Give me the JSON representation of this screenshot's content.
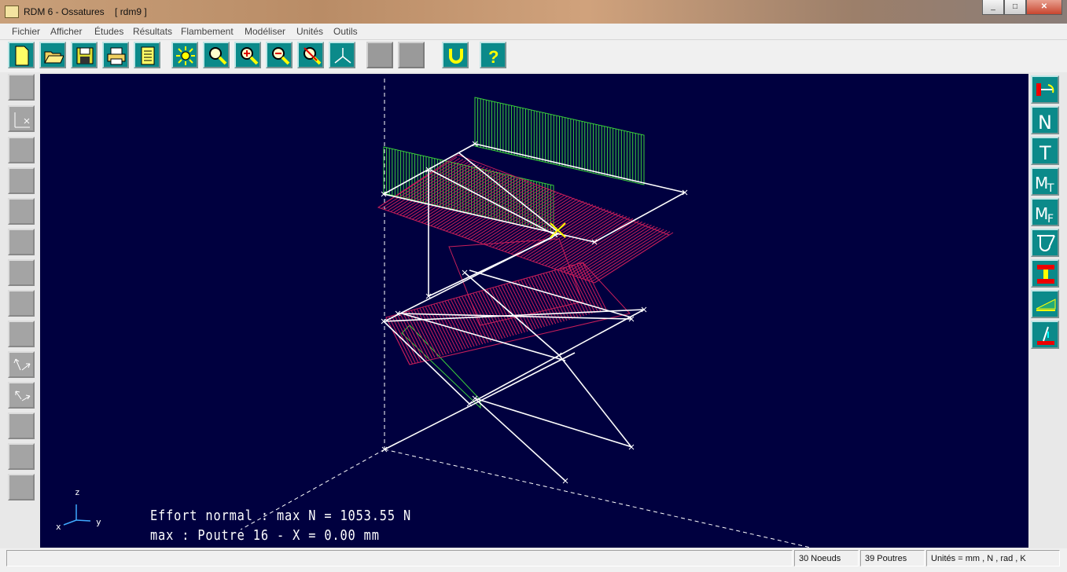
{
  "window": {
    "title": "RDM 6 - Ossatures    [ rdm9 ]",
    "controls": [
      "_",
      "□",
      "✕"
    ]
  },
  "menu": [
    "Fichier",
    "Afficher",
    "Études",
    "Résultats",
    "Flambement",
    "Modéliser",
    "Unités",
    "Outils"
  ],
  "toolbar": {
    "buttons": [
      "new-file",
      "open-folder",
      "save-disk",
      "print",
      "document-list",
      "light",
      "zoom",
      "zoom-in",
      "zoom-out",
      "zoom-reset",
      "axes",
      "blank",
      "blank",
      "magnet",
      "help"
    ]
  },
  "left_toolbar": {
    "count": 14
  },
  "right_toolbar": {
    "buttons": [
      "beam-load",
      "N",
      "T",
      "Mt",
      "Mf",
      "stress",
      "section",
      "distributed-load",
      "support"
    ]
  },
  "viewport": {
    "info_line1": "Effort normal : max N = 1053.55 N",
    "info_line2": "max : Poutre 16 - X = 0.00 mm",
    "axis": {
      "z": "z",
      "x": "x",
      "y": "y"
    },
    "background": "#00003f"
  },
  "status": {
    "nodes": "30 Noeuds",
    "beams": "39 Poutres",
    "units": "Unités = mm , N , rad , K"
  }
}
